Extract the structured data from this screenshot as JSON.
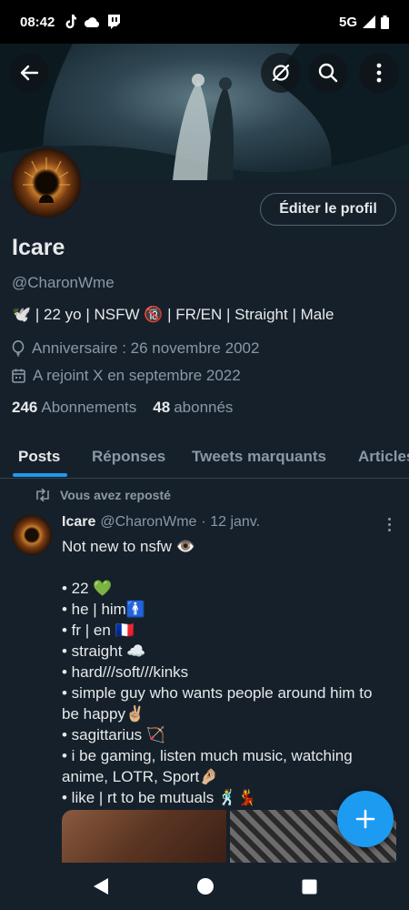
{
  "status_bar": {
    "time": "08:42",
    "network": "5G"
  },
  "colors": {
    "accent": "#1d9bf0",
    "background": "#15202b",
    "text_secondary": "#8b98a5",
    "divider": "#38444d"
  },
  "header": {
    "back_icon": "arrow-left-icon",
    "icons": [
      "eye-off-icon",
      "search-icon",
      "more-vertical-icon"
    ]
  },
  "profile": {
    "edit_label": "Éditer le profil",
    "name": "Icare",
    "handle": "@CharonWme",
    "bio": "🕊️ | 22 yo | NSFW 🔞 | FR/EN | Straight | Male",
    "birthday": "Anniversaire : 26 novembre 2002",
    "joined": "A rejoint X en septembre 2022",
    "following_count": "246",
    "following_label": "Abonnements",
    "followers_count": "48",
    "followers_label": "abonnés"
  },
  "tabs": [
    {
      "label": "Posts",
      "active": true
    },
    {
      "label": "Réponses",
      "active": false
    },
    {
      "label": "Tweets marquants",
      "active": false
    },
    {
      "label": "Articles",
      "active": false
    }
  ],
  "tweet": {
    "repost_label": "Vous avez reposté",
    "author_name": "Icare",
    "author_handle": "@CharonWme",
    "date": "· 12 janv.",
    "lines": [
      "Not new to nsfw 👁️",
      "",
      "• 22 💚",
      "• he | him🚹",
      "• fr | en 🇫🇷",
      "• straight ☁️",
      "• hard///soft///kinks",
      "• simple guy who wants people around him to",
      "be happy✌🏼",
      "• sagittarius 🏹",
      "• i be gaming, listen much music, watching",
      "anime, LOTR, Sport🤌🏼",
      "• like | rt to be mutuals 🕺💃"
    ]
  },
  "fab_icon": "plus-icon",
  "nav_bar": [
    "back-triangle-icon",
    "home-circle-icon",
    "recents-square-icon"
  ]
}
